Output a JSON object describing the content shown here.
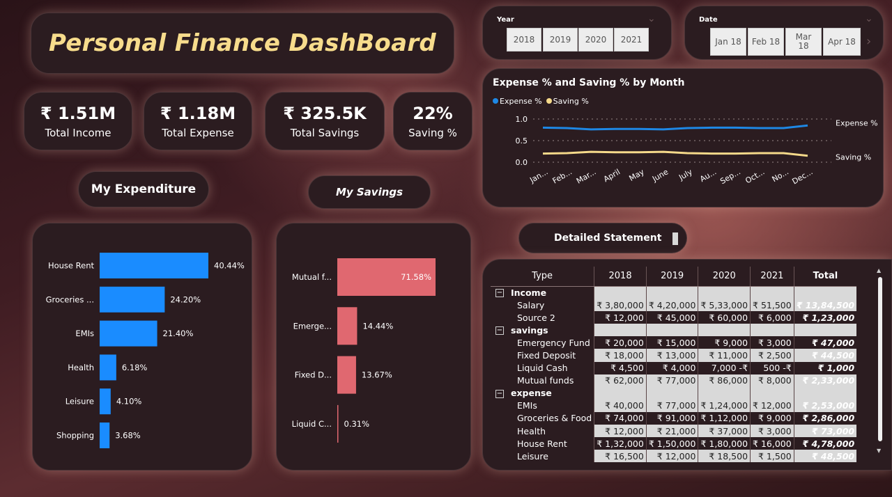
{
  "title": "Personal Finance DashBoard",
  "kpis": [
    {
      "value": "₹ 1.51M",
      "label": "Total Income"
    },
    {
      "value": "₹ 1.18M",
      "label": "Total Expense"
    },
    {
      "value": "₹ 325.5K",
      "label": "Total Savings"
    },
    {
      "value": "22%",
      "label": "Saving %"
    }
  ],
  "year_slicer": {
    "title": "Year",
    "options": [
      "2018",
      "2019",
      "2020",
      "2021"
    ]
  },
  "date_slicer": {
    "title": "Date",
    "options": [
      "Jan 18",
      "Feb 18",
      "Mar 18",
      "Apr 18"
    ]
  },
  "section_headers": {
    "expenditure": "My Expenditure",
    "savings": "My Savings",
    "statement": "Detailed Statement"
  },
  "colors": {
    "expense_bar": "#1a8cff",
    "savings_bar": "#e06870",
    "expense_line": "#1e88e5",
    "saving_line": "#f5d98a",
    "title_gold": "#f7dc8c"
  },
  "chart_data": [
    {
      "type": "bar",
      "orientation": "horizontal",
      "categories": [
        "House Rent",
        "Groceries ...",
        "EMIs",
        "Health",
        "Leisure",
        "Shopping"
      ],
      "values": [
        40.44,
        24.2,
        21.4,
        6.18,
        4.1,
        3.68
      ],
      "value_labels": [
        "40.44%",
        "24.20%",
        "21.40%",
        "6.18%",
        "4.10%",
        "3.68%"
      ]
    },
    {
      "type": "bar",
      "orientation": "horizontal",
      "categories": [
        "Mutual f...",
        "Emerge...",
        "Fixed D...",
        "Liquid C..."
      ],
      "values": [
        71.58,
        14.44,
        13.67,
        0.31
      ],
      "value_labels": [
        "71.58%",
        "14.44%",
        "13.67%",
        "0.31%"
      ]
    },
    {
      "type": "line",
      "title": "Expense % and Saving % by Month",
      "x": [
        "Jan...",
        "Feb...",
        "Mar...",
        "April",
        "May",
        "June",
        "July",
        "Au...",
        "Sep...",
        "Oct...",
        "No...",
        "Dec..."
      ],
      "series": [
        {
          "name": "Expense %",
          "values": [
            0.8,
            0.79,
            0.76,
            0.77,
            0.77,
            0.76,
            0.79,
            0.8,
            0.8,
            0.79,
            0.79,
            0.85
          ]
        },
        {
          "name": "Saving %",
          "values": [
            0.2,
            0.21,
            0.24,
            0.23,
            0.23,
            0.24,
            0.21,
            0.2,
            0.2,
            0.21,
            0.21,
            0.15
          ]
        }
      ],
      "yticks": [
        "0.0",
        "0.5",
        "1.0"
      ],
      "ylim": [
        0,
        1
      ],
      "legend_position": "top-left",
      "grid": true
    }
  ],
  "statement": {
    "columns": [
      "Type",
      "2018",
      "2019",
      "2020",
      "2021",
      "Total"
    ],
    "rows": [
      {
        "kind": "group",
        "label": "Income"
      },
      {
        "kind": "item",
        "label": "Salary",
        "cells": [
          "₹ 3,80,000",
          "₹ 4,20,000",
          "₹ 5,33,000",
          "₹ 51,500",
          "₹ 13,84,500"
        ],
        "shade": true
      },
      {
        "kind": "item",
        "label": "Source 2",
        "cells": [
          "₹ 12,000",
          "₹ 45,000",
          "₹ 60,000",
          "₹ 6,000",
          "₹ 1,23,000"
        ],
        "shade": false
      },
      {
        "kind": "group",
        "label": "savings"
      },
      {
        "kind": "item",
        "label": "Emergency Fund",
        "cells": [
          "₹ 20,000",
          "₹ 15,000",
          "₹ 9,000",
          "₹ 3,000",
          "₹ 47,000"
        ],
        "shade": false
      },
      {
        "kind": "item",
        "label": "Fixed Deposit",
        "cells": [
          "₹ 18,000",
          "₹ 13,000",
          "₹ 11,000",
          "₹ 2,500",
          "₹ 44,500"
        ],
        "shade": true
      },
      {
        "kind": "item",
        "label": "Liquid Cash",
        "cells": [
          "₹ 4,500",
          "₹ 4,000",
          "7,000 -₹",
          "500 -₹",
          "₹ 1,000"
        ],
        "shade": false
      },
      {
        "kind": "item",
        "label": "Mutual funds",
        "cells": [
          "₹ 62,000",
          "₹ 77,000",
          "₹ 86,000",
          "₹ 8,000",
          "₹ 2,33,000"
        ],
        "shade": true
      },
      {
        "kind": "group",
        "label": "expense"
      },
      {
        "kind": "item",
        "label": "EMIs",
        "cells": [
          "₹ 40,000",
          "₹ 77,000",
          "₹ 1,24,000",
          "₹ 12,000",
          "₹ 2,53,000"
        ],
        "shade": true
      },
      {
        "kind": "item",
        "label": "Groceries & Food",
        "cells": [
          "₹ 74,000",
          "₹ 91,000",
          "₹ 1,12,000",
          "₹ 9,000",
          "₹ 2,86,000"
        ],
        "shade": false
      },
      {
        "kind": "item",
        "label": "Health",
        "cells": [
          "₹ 12,000",
          "₹ 21,000",
          "₹ 37,000",
          "₹ 3,000",
          "₹ 73,000"
        ],
        "shade": true
      },
      {
        "kind": "item",
        "label": "House Rent",
        "cells": [
          "₹ 1,32,000",
          "₹ 1,50,000",
          "₹ 1,80,000",
          "₹ 16,000",
          "₹ 4,78,000"
        ],
        "shade": false
      },
      {
        "kind": "item",
        "label": "Leisure",
        "cells": [
          "₹ 16,500",
          "₹ 12,000",
          "₹ 18,500",
          "₹ 1,500",
          "₹ 48,500"
        ],
        "shade": true
      }
    ]
  }
}
